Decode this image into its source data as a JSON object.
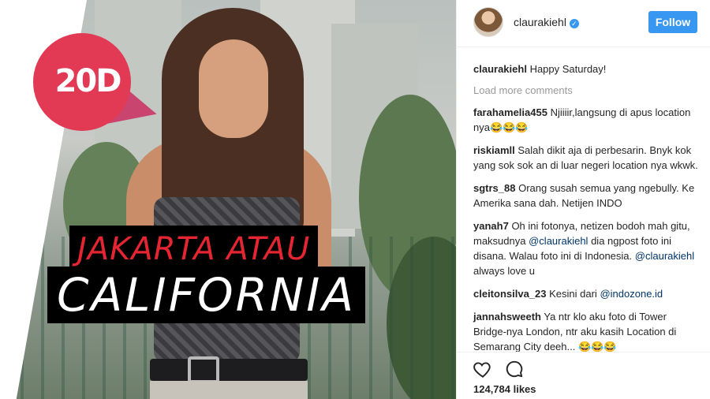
{
  "logo": {
    "text": "20D"
  },
  "headline": {
    "line1": "JAKARTA ATAU",
    "line2": "CALIFORNIA"
  },
  "post": {
    "username": "claurakiehl",
    "follow_label": "Follow",
    "caption_user": "claurakiehl",
    "caption_text": "Happy Saturday!",
    "load_more": "Load more comments",
    "likes": "124,784 likes"
  },
  "comments": [
    {
      "user": "farahamelia455",
      "text": "Njiiiir,langsung di apus location nya😂😂😂"
    },
    {
      "user": "riskiamll",
      "text": "Salah dikit aja di perbesarin. Bnyk kok yang sok sok an di luar negeri location nya wkwk."
    },
    {
      "user": "sgtrs_88",
      "text": "Orang susah semua yang ngebully. Ke Amerika sana dah. Netijen INDO"
    },
    {
      "user": "yanah7",
      "text_a": "Oh ini fotonya, netizen bodoh mah gitu, maksudnya",
      "mention_a": "@claurakiehl",
      "text_b": "dia ngpost foto ini disana. Walau foto ini di Indonesia.",
      "mention_b": "@claurakiehl",
      "text_c": "always love u"
    },
    {
      "user": "cleitonsilva_23",
      "text": "Kesini dari",
      "mention": "@indozone.id"
    },
    {
      "user": "jannahsweeth",
      "text": "Ya ntr klo aku foto di Tower Bridge-nya London, ntr aku kasih Location di Semarang City deeh... 😂😂😂"
    }
  ],
  "colors": {
    "accent": "#3897f0",
    "logo": "#e23a55",
    "headline_red": "#e52632",
    "mention": "#003569"
  },
  "icons": [
    "heart-icon",
    "comment-icon",
    "verified-badge-icon"
  ]
}
